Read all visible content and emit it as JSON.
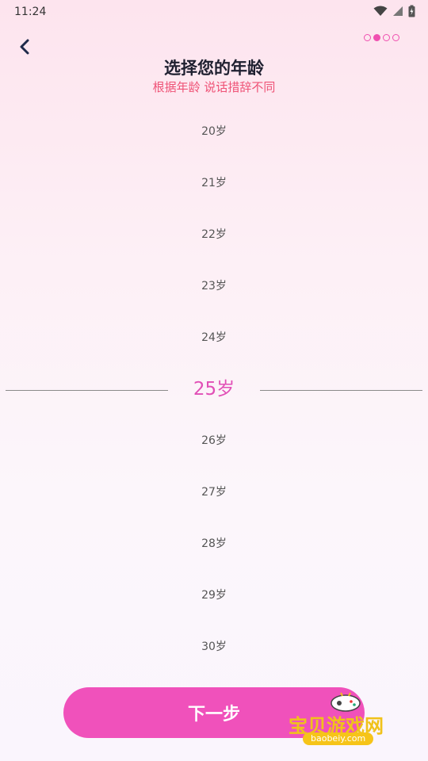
{
  "status_bar": {
    "time": "11:24"
  },
  "header": {
    "title": "选择您的年龄",
    "subtitle": "根据年龄 说话措辞不同",
    "progress": {
      "total_steps": 4,
      "current_step": 2
    }
  },
  "picker": {
    "items": [
      "20岁",
      "21岁",
      "22岁",
      "23岁",
      "24岁",
      "25岁",
      "26岁",
      "27岁",
      "28岁",
      "29岁",
      "30岁"
    ],
    "selected_index": 5
  },
  "footer": {
    "next_label": "下一步"
  },
  "watermark": {
    "brand": "宝贝游戏网",
    "domain": "baobeiy.com"
  },
  "colors": {
    "accent": "#f051bb",
    "selected_text": "#e14fb6",
    "subtitle": "#ef5276",
    "title": "#1f2030"
  }
}
